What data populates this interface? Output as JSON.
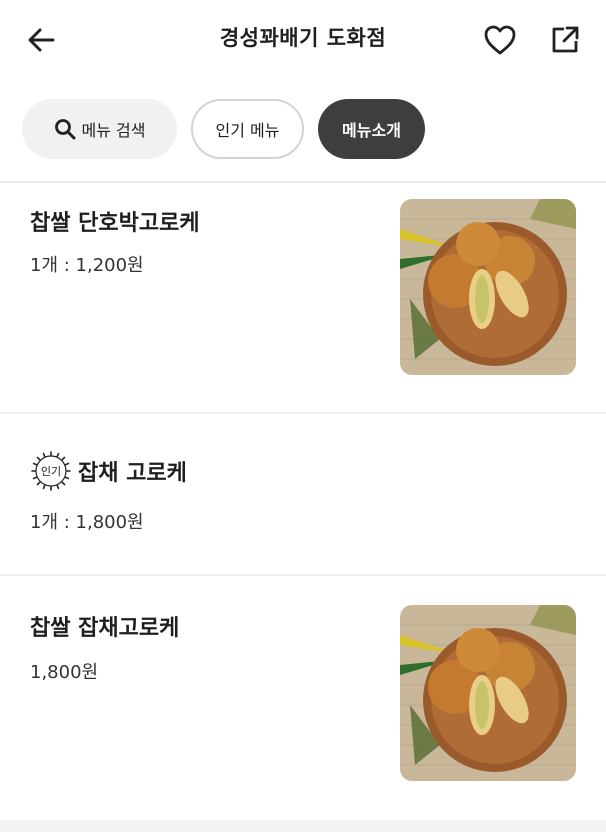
{
  "header": {
    "title": "경성꽈배기 도화점"
  },
  "chips": {
    "search_label": "메뉴 검색",
    "popular_label": "인기 메뉴",
    "intro_label": "메뉴소개"
  },
  "badge": {
    "popular_text": "인기"
  },
  "items": [
    {
      "name": "찹쌀 단호박고로케",
      "price": "1개 : 1,200원"
    },
    {
      "name": "잡채 고로케",
      "price": "1개 : 1,800원"
    },
    {
      "name": "찹쌀 잡채고로케",
      "price": "1,800원"
    }
  ]
}
